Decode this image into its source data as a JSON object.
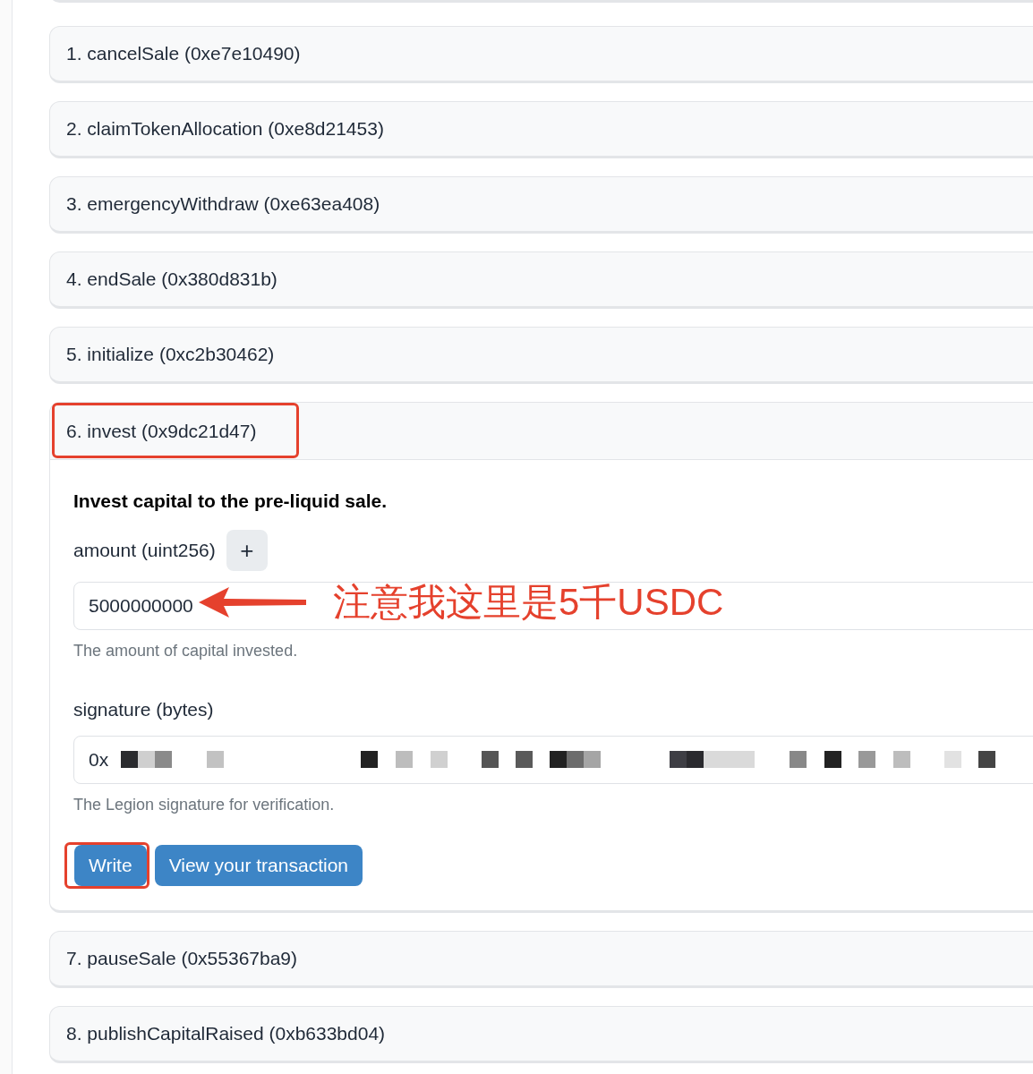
{
  "functions": [
    {
      "label": "1. cancelSale (0xe7e10490)",
      "expanded": false,
      "highlighted": false
    },
    {
      "label": "2. claimTokenAllocation (0xe8d21453)",
      "expanded": false,
      "highlighted": false
    },
    {
      "label": "3. emergencyWithdraw (0xe63ea408)",
      "expanded": false,
      "highlighted": false
    },
    {
      "label": "4. endSale (0x380d831b)",
      "expanded": false,
      "highlighted": false
    },
    {
      "label": "5. initialize (0xc2b30462)",
      "expanded": false,
      "highlighted": false
    },
    {
      "label": "6. invest (0x9dc21d47)",
      "expanded": true,
      "highlighted": true,
      "description": "Invest capital to the pre-liquid sale.",
      "params": [
        {
          "kind": "number",
          "label": "amount (uint256)",
          "add_button": "+",
          "value": "5000000000",
          "help": "The amount of capital invested.",
          "note": "注意我这里是5千USDC"
        },
        {
          "kind": "redacted",
          "label": "signature (bytes)",
          "value": "0x",
          "help": "The Legion signature for verification."
        }
      ],
      "buttons": [
        {
          "label": "Write",
          "highlighted": true
        },
        {
          "label": "View your transaction",
          "highlighted": false
        }
      ]
    },
    {
      "label": "7. pauseSale (0x55367ba9)",
      "expanded": false,
      "highlighted": false
    },
    {
      "label": "8. publishCapitalRaised (0xb633bd04)",
      "expanded": false,
      "highlighted": false
    }
  ]
}
